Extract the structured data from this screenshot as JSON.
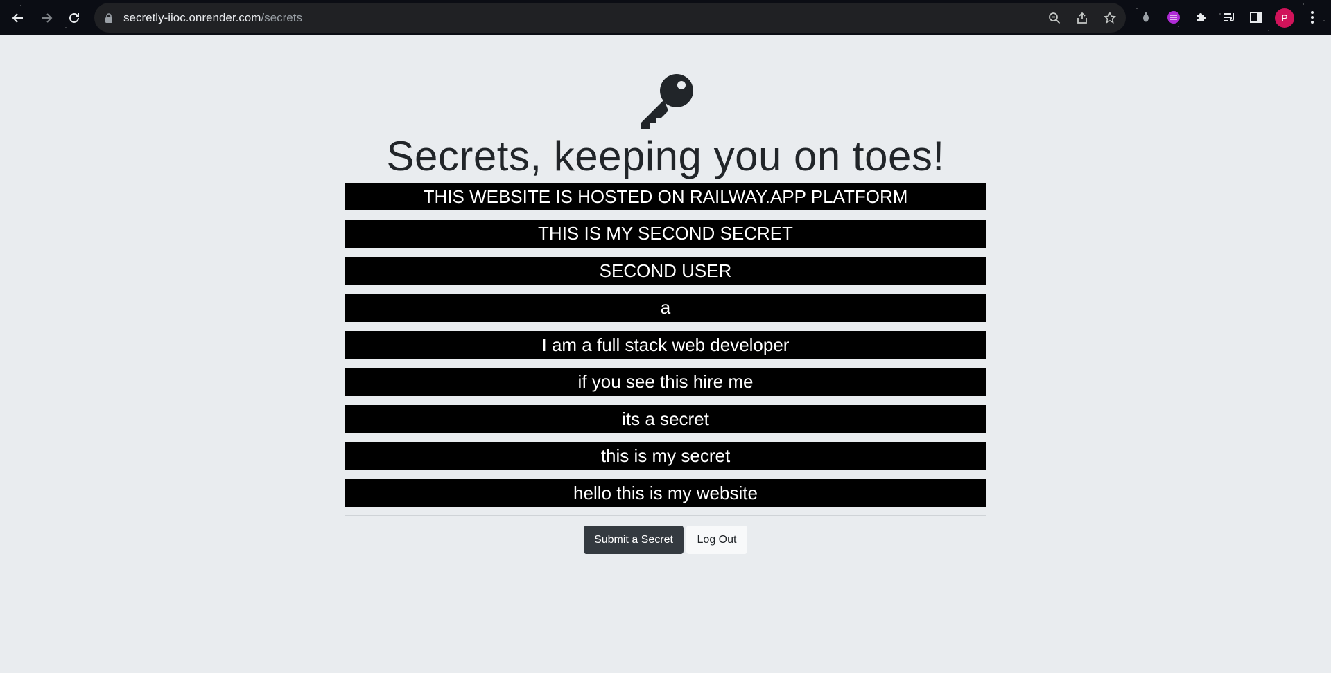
{
  "browser": {
    "url_host": "secretly-iioc.onrender.com",
    "url_path": "/secrets",
    "profile_initial": "P",
    "icons": {
      "back": "arrow-left-icon",
      "forward": "arrow-right-icon",
      "reload": "reload-icon",
      "lock": "lock-icon",
      "zoom": "zoom-out-icon",
      "share": "share-icon",
      "bookmark": "star-icon",
      "extension1": "bug-icon",
      "extension2": "purple-extension-icon",
      "extensions": "puzzle-icon",
      "reading_list": "reading-list-icon",
      "side_panel": "side-panel-icon",
      "menu": "kebab-menu-icon"
    }
  },
  "page": {
    "icon": "key-icon",
    "title": "Secrets, keeping you on toes!",
    "secrets": [
      "THIS WEBSITE IS HOSTED ON RAILWAY.APP PLATFORM",
      "THIS IS MY SECOND SECRET",
      "SECOND USER",
      "a",
      "I am a full stack web developer",
      "if you see this hire me",
      "its a secret",
      "this is my secret",
      "hello this is my website"
    ],
    "submit_label": "Submit a Secret",
    "logout_label": "Log Out"
  },
  "colors": {
    "page_bg": "#e9ecef",
    "secret_bg": "#000000",
    "submit_bg": "#343a40",
    "avatar_bg": "#d0135a"
  }
}
